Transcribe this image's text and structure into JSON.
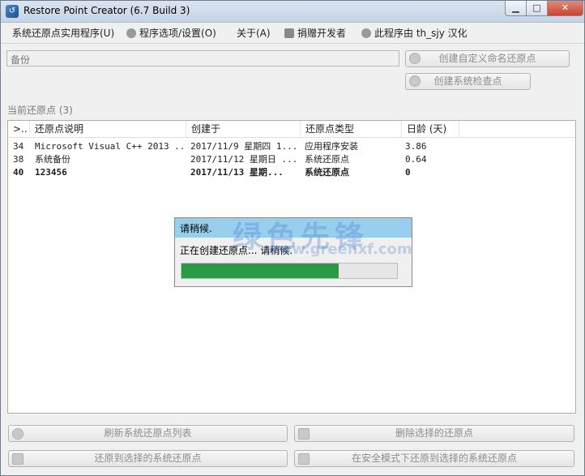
{
  "window": {
    "title": "Restore Point Creator (6.7 Build 3)",
    "minimize": "▁",
    "maximize": "□",
    "close": "✕"
  },
  "menu": {
    "items": [
      "系统还原点实用程序(U)",
      "程序选项/设置(O)",
      "关于(A)",
      "捐赠开发者",
      "此程序由 th_sjy 汉化"
    ]
  },
  "backup_field": {
    "value": "备份"
  },
  "buttons": {
    "create_custom": "创建自定义命名还原点",
    "create_check": "创建系统检查点",
    "refresh": "刷新系统还原点列表",
    "delete": "删除选择的还原点",
    "restore": "还原到选择的系统还原点",
    "restore_safe": "在安全模式下还原到选择的系统还原点"
  },
  "restore_points_label": "当前还原点 (3)",
  "table": {
    "headers": [
      ">..",
      "还原点说明",
      "创建于",
      "还原点类型",
      "日龄 (天)"
    ],
    "rows": [
      {
        "id": "34",
        "desc": "Microsoft Visual C++ 2013 ...",
        "created": "2017/11/9 星期四 1...",
        "type": "应用程序安装",
        "age": "3.86"
      },
      {
        "id": "38",
        "desc": "系统备份",
        "created": "2017/11/12 星期日 ...",
        "type": "系统还原点",
        "age": "0.64"
      },
      {
        "id": "40",
        "desc": "123456",
        "created": "2017/11/13 星期...",
        "type": "系统还原点",
        "age": "0"
      }
    ]
  },
  "dialog": {
    "title": "请稍候.",
    "message": "正在创建还原点... 请稍候.",
    "progress": 0.73
  },
  "watermark": {
    "main": "绿色先锋",
    "sub": "www.greenxf.com"
  },
  "colors": {
    "dialog_title_bg": "#99cfee",
    "progress_fill": "#2a9a45"
  }
}
